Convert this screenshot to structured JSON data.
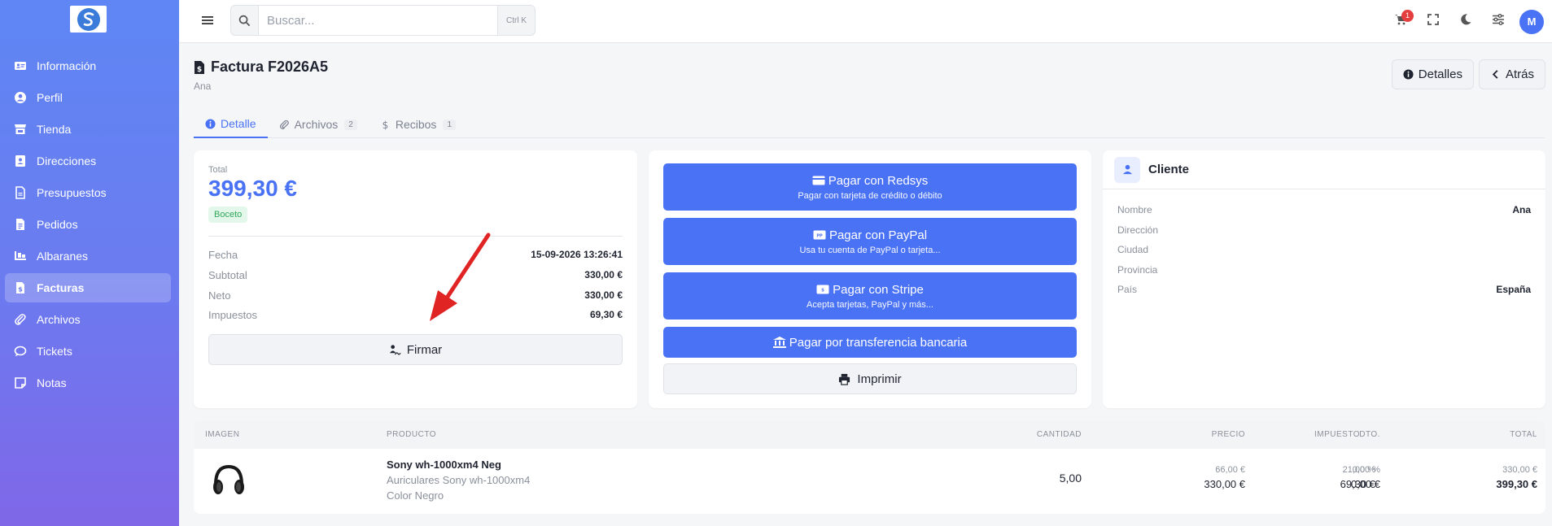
{
  "search": {
    "placeholder": "Buscar...",
    "shortcut": "Ctrl K"
  },
  "cart": {
    "count": "1"
  },
  "user": {
    "initial": "M"
  },
  "sidebar": {
    "items": [
      {
        "label": "Información",
        "icon": "id-card-icon"
      },
      {
        "label": "Perfil",
        "icon": "user-circle-icon"
      },
      {
        "label": "Tienda",
        "icon": "store-icon"
      },
      {
        "label": "Direcciones",
        "icon": "address-book-icon"
      },
      {
        "label": "Presupuestos",
        "icon": "file-icon"
      },
      {
        "label": "Pedidos",
        "icon": "file-text-icon"
      },
      {
        "label": "Albaranes",
        "icon": "truck-loading-icon"
      },
      {
        "label": "Facturas",
        "icon": "invoice-icon",
        "active": true
      },
      {
        "label": "Archivos",
        "icon": "paperclip-icon"
      },
      {
        "label": "Tickets",
        "icon": "chat-icon"
      },
      {
        "label": "Notas",
        "icon": "note-icon"
      }
    ]
  },
  "header": {
    "title": "Factura F2026A5",
    "subtitle": "Ana",
    "details_label": "Detalles",
    "back_label": "Atrás"
  },
  "tabs": [
    {
      "label": "Detalle",
      "count": ""
    },
    {
      "label": "Archivos",
      "count": "2"
    },
    {
      "label": "Recibos",
      "count": "1"
    }
  ],
  "summary": {
    "total_label": "Total",
    "total_value": "399,30 €",
    "status": "Boceto",
    "rows": [
      {
        "k": "Fecha",
        "v": "15-09-2026 13:26:41"
      },
      {
        "k": "Subtotal",
        "v": "330,00 €"
      },
      {
        "k": "Neto",
        "v": "330,00 €"
      },
      {
        "k": "Impuestos",
        "v": "69,30 €"
      }
    ],
    "sign_label": "Firmar"
  },
  "payments": {
    "redsys": {
      "title": "Pagar con Redsys",
      "sub": "Pagar con tarjeta de crédito o débito"
    },
    "paypal": {
      "title": "Pagar con PayPal",
      "sub": "Usa tu cuenta de PayPal o tarjeta..."
    },
    "stripe": {
      "title": "Pagar con Stripe",
      "sub": "Acepta tarjetas, PayPal y más..."
    },
    "transfer": {
      "title": "Pagar por transferencia bancaria"
    },
    "print_label": "Imprimir"
  },
  "client": {
    "title": "Cliente",
    "rows": [
      {
        "k": "Nombre",
        "v": "Ana"
      },
      {
        "k": "Dirección",
        "v": ""
      },
      {
        "k": "Ciudad",
        "v": ""
      },
      {
        "k": "Provincia",
        "v": ""
      },
      {
        "k": "País",
        "v": "España"
      }
    ]
  },
  "table": {
    "headers": {
      "image": "IMAGEN",
      "product": "PRODUCTO",
      "qty": "CANTIDAD",
      "price": "PRECIO",
      "dto": "DTO.",
      "tax": "IMPUESTO",
      "total": "TOTAL"
    },
    "rows": [
      {
        "name": "Sony wh-1000xm4 Neg",
        "desc": "Auriculares Sony wh-1000xm4",
        "variant": "Color Negro",
        "qty": "5,00",
        "price_unit": "66,00 €",
        "price_total": "330,00 €",
        "dto_pct": "0,00 %",
        "dto_val": "0,00 €",
        "tax_pct": "21,00 %",
        "tax_val": "69,30 €",
        "total_sub": "330,00 €",
        "total": "399,30 €"
      }
    ]
  },
  "colors": {
    "accent": "#4a72f5",
    "status_green": "#2fa85a",
    "arrow": "#e02424"
  }
}
